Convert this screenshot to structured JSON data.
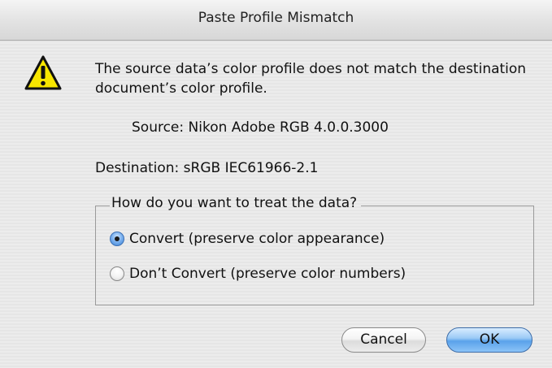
{
  "window": {
    "title": "Paste Profile Mismatch"
  },
  "alert": {
    "icon": "warning-icon",
    "message": "The source data’s color profile does not match the destination document’s color profile.",
    "source": "Source: Nikon Adobe RGB 4.0.0.3000",
    "destination": "Destination: sRGB IEC61966-2.1"
  },
  "options": {
    "legend": "How do you want to treat the data?",
    "items": [
      {
        "label": "Convert (preserve color appearance)",
        "selected": true
      },
      {
        "label": "Don’t Convert (preserve color numbers)",
        "selected": false
      }
    ]
  },
  "buttons": {
    "cancel": "Cancel",
    "ok": "OK"
  },
  "colors": {
    "accent": "#5aa2ea",
    "warning_yellow": "#f7e600"
  }
}
